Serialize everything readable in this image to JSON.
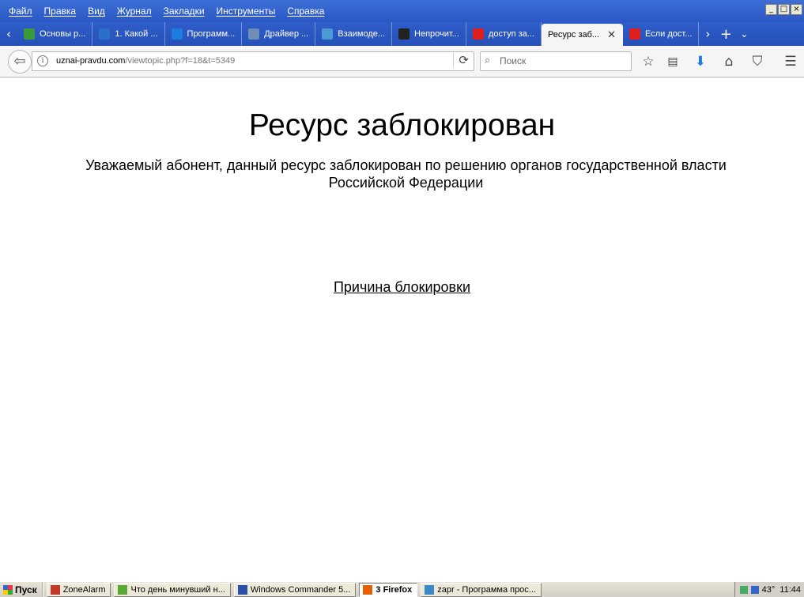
{
  "menu": [
    "Файл",
    "Правка",
    "Вид",
    "Журнал",
    "Закладки",
    "Инструменты",
    "Справка"
  ],
  "window_controls": {
    "minimize": "_",
    "maximize": "□",
    "close": "×"
  },
  "tabs": [
    {
      "label": "Основы р...",
      "icon": "green-leaf-icon",
      "color": "#3c9a3c"
    },
    {
      "label": "1. Какой ...",
      "icon": "blue-s-icon",
      "color": "#2a6fc9"
    },
    {
      "label": "Программ...",
      "icon": "blue-circle-icon",
      "color": "#1e7be0"
    },
    {
      "label": "Драйвер ...",
      "icon": "h-letter-icon",
      "color": "#6d8fb5"
    },
    {
      "label": "Взаимоде...",
      "icon": "network-icon",
      "color": "#4a9ad6"
    },
    {
      "label": "Непрочит...",
      "icon": "soccer-ball-icon",
      "color": "#222222"
    },
    {
      "label": "доступ за...",
      "icon": "yandex-icon",
      "color": "#e02020"
    },
    {
      "label": "Ресурс заб...",
      "icon": "none",
      "color": "#f5f5f5",
      "active": true
    },
    {
      "label": "Если дост...",
      "icon": "yandex-icon",
      "color": "#e02020"
    }
  ],
  "tab_scroll_left": "‹",
  "tab_scroll_right": "›",
  "tab_new": "+",
  "tab_list": "⌄",
  "url": {
    "host": "uznai-pravdu.com",
    "path": "/viewtopic.php?f=18&t=5349"
  },
  "search": {
    "placeholder": "Поиск"
  },
  "page": {
    "headline": "Ресурс заблокирован",
    "notice": "Уважаемый абонент, данный ресурс заблокирован по решению органов государственной власти Российской Федерации",
    "reason_link": "Причина блокировки"
  },
  "taskbar": {
    "start": "Пуск",
    "items": [
      {
        "label": "ZoneAlarm",
        "color": "#c0392b"
      },
      {
        "label": "Что день минувший н...",
        "color": "#5aa832"
      },
      {
        "label": "Windows Commander 5...",
        "color": "#2a4fa8"
      },
      {
        "label": "3 Firefox",
        "color": "#e66000",
        "active": true
      },
      {
        "label": "zapr - Программа прос...",
        "color": "#3a8ac9"
      }
    ],
    "clock": "11:44",
    "temp": "43°"
  }
}
